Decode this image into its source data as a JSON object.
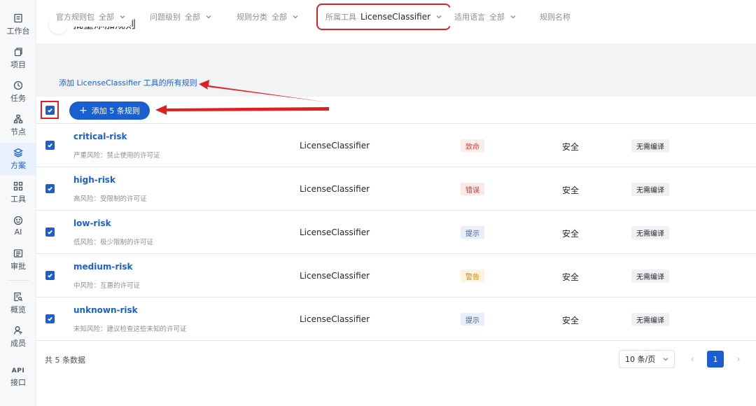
{
  "sidebar": {
    "items": [
      {
        "label": "工作台",
        "icon": "document-icon"
      },
      {
        "label": "项目",
        "icon": "copy-icon"
      },
      {
        "label": "任务",
        "icon": "clock-icon"
      },
      {
        "label": "节点",
        "icon": "hierarchy-icon"
      },
      {
        "label": "方案",
        "icon": "layers-icon",
        "active": true
      },
      {
        "label": "工具",
        "icon": "grid-icon"
      },
      {
        "label": "AI",
        "icon": "smile-icon"
      },
      {
        "label": "审批",
        "icon": "list-icon"
      },
      {
        "label": "概览",
        "icon": "report-search-icon"
      },
      {
        "label": "成员",
        "icon": "user-icon"
      },
      {
        "label": "接口",
        "icon": "api-icon",
        "glyph": "API"
      }
    ]
  },
  "header": {
    "title": "批量添加规则",
    "back_arrow": "←"
  },
  "filters": [
    {
      "label": "官方规则包",
      "value": "全部"
    },
    {
      "label": "问题级别",
      "value": "全部"
    },
    {
      "label": "规则分类",
      "value": "全部"
    },
    {
      "label": "所属工具",
      "value": "LicenseClassifier"
    },
    {
      "label": "适用语言",
      "value": "全部"
    },
    {
      "placeholder": "规则名称"
    }
  ],
  "add_all_link": "添加 LicenseClassifier 工具的所有规则",
  "toolbar": {
    "add_button_label": "添加 5 条规则",
    "plus": "+"
  },
  "rules": [
    {
      "name": "critical-risk",
      "desc": "严重风险：禁止使用的许可证",
      "tool": "LicenseClassifier",
      "severity": "致命",
      "category": "安全",
      "compile": "无需编译"
    },
    {
      "name": "high-risk",
      "desc": "高风险：受限制的许可证",
      "tool": "LicenseClassifier",
      "severity": "错误",
      "category": "安全",
      "compile": "无需编译"
    },
    {
      "name": "low-risk",
      "desc": "低风险：极少限制的许可证",
      "tool": "LicenseClassifier",
      "severity": "提示",
      "category": "安全",
      "compile": "无需编译"
    },
    {
      "name": "medium-risk",
      "desc": "中风险：互惠的许可证",
      "tool": "LicenseClassifier",
      "severity": "警告",
      "category": "安全",
      "compile": "无需编译"
    },
    {
      "name": "unknown-risk",
      "desc": "未知风险：建议检查这些未知的许可证",
      "tool": "LicenseClassifier",
      "severity": "提示",
      "category": "安全",
      "compile": "无需编译"
    }
  ],
  "severity_colors": {
    "致命": {
      "bg": "#fdecec",
      "fg": "#e0443a"
    },
    "错误": {
      "bg": "#fbe9e9",
      "fg": "#c0392b"
    },
    "提示": {
      "bg": "#e8effa",
      "fg": "#3a5f9e"
    },
    "警告": {
      "bg": "#fdf3e1",
      "fg": "#c98a10"
    }
  },
  "footer": {
    "total": "共 5 条数据",
    "page_size": "10 条/页",
    "current_page": "1",
    "prev": "‹",
    "next": "›"
  },
  "colors": {
    "accent": "#1a5fd1",
    "annotation": "#e02020"
  }
}
